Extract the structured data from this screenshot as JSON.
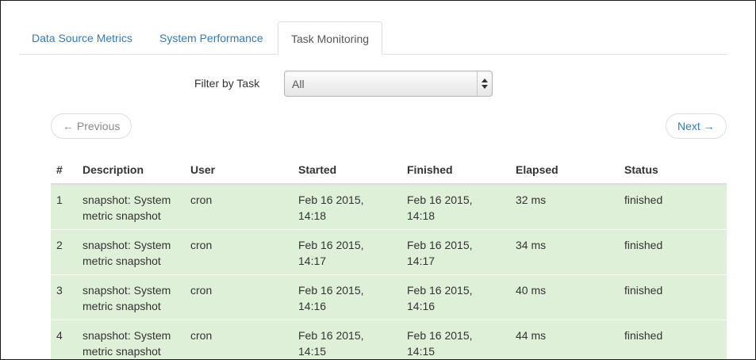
{
  "tabs": [
    {
      "label": "Data Source Metrics",
      "active": false
    },
    {
      "label": "System Performance",
      "active": false
    },
    {
      "label": "Task Monitoring",
      "active": true
    }
  ],
  "filter": {
    "label": "Filter by Task",
    "selected": "All"
  },
  "pager": {
    "previous": "← Previous",
    "next": "Next →"
  },
  "table": {
    "headers": [
      "#",
      "Description",
      "User",
      "Started",
      "Finished",
      "Elapsed",
      "Status"
    ],
    "rows": [
      {
        "num": "1",
        "desc_line1": "snapshot: System",
        "desc_line2": "metric snapshot",
        "user": "cron",
        "started_line1": "Feb 16 2015,",
        "started_line2": "14:18",
        "finished_line1": "Feb 16 2015,",
        "finished_line2": "14:18",
        "elapsed": "32 ms",
        "status": "finished"
      },
      {
        "num": "2",
        "desc_line1": "snapshot: System",
        "desc_line2": "metric snapshot",
        "user": "cron",
        "started_line1": "Feb 16 2015,",
        "started_line2": "14:17",
        "finished_line1": "Feb 16 2015,",
        "finished_line2": "14:17",
        "elapsed": "34 ms",
        "status": "finished"
      },
      {
        "num": "3",
        "desc_line1": "snapshot: System",
        "desc_line2": "metric snapshot",
        "user": "cron",
        "started_line1": "Feb 16 2015,",
        "started_line2": "14:16",
        "finished_line1": "Feb 16 2015,",
        "finished_line2": "14:16",
        "elapsed": "40 ms",
        "status": "finished"
      },
      {
        "num": "4",
        "desc_line1": "snapshot: System",
        "desc_line2": "metric snapshot",
        "user": "cron",
        "started_line1": "Feb 16 2015,",
        "started_line2": "14:15",
        "finished_line1": "Feb 16 2015,",
        "finished_line2": "14:15",
        "elapsed": "44 ms",
        "status": "finished"
      }
    ]
  },
  "colors": {
    "link": "#337ab7",
    "success_row": "#dff0d8",
    "border": "#dddddd"
  }
}
